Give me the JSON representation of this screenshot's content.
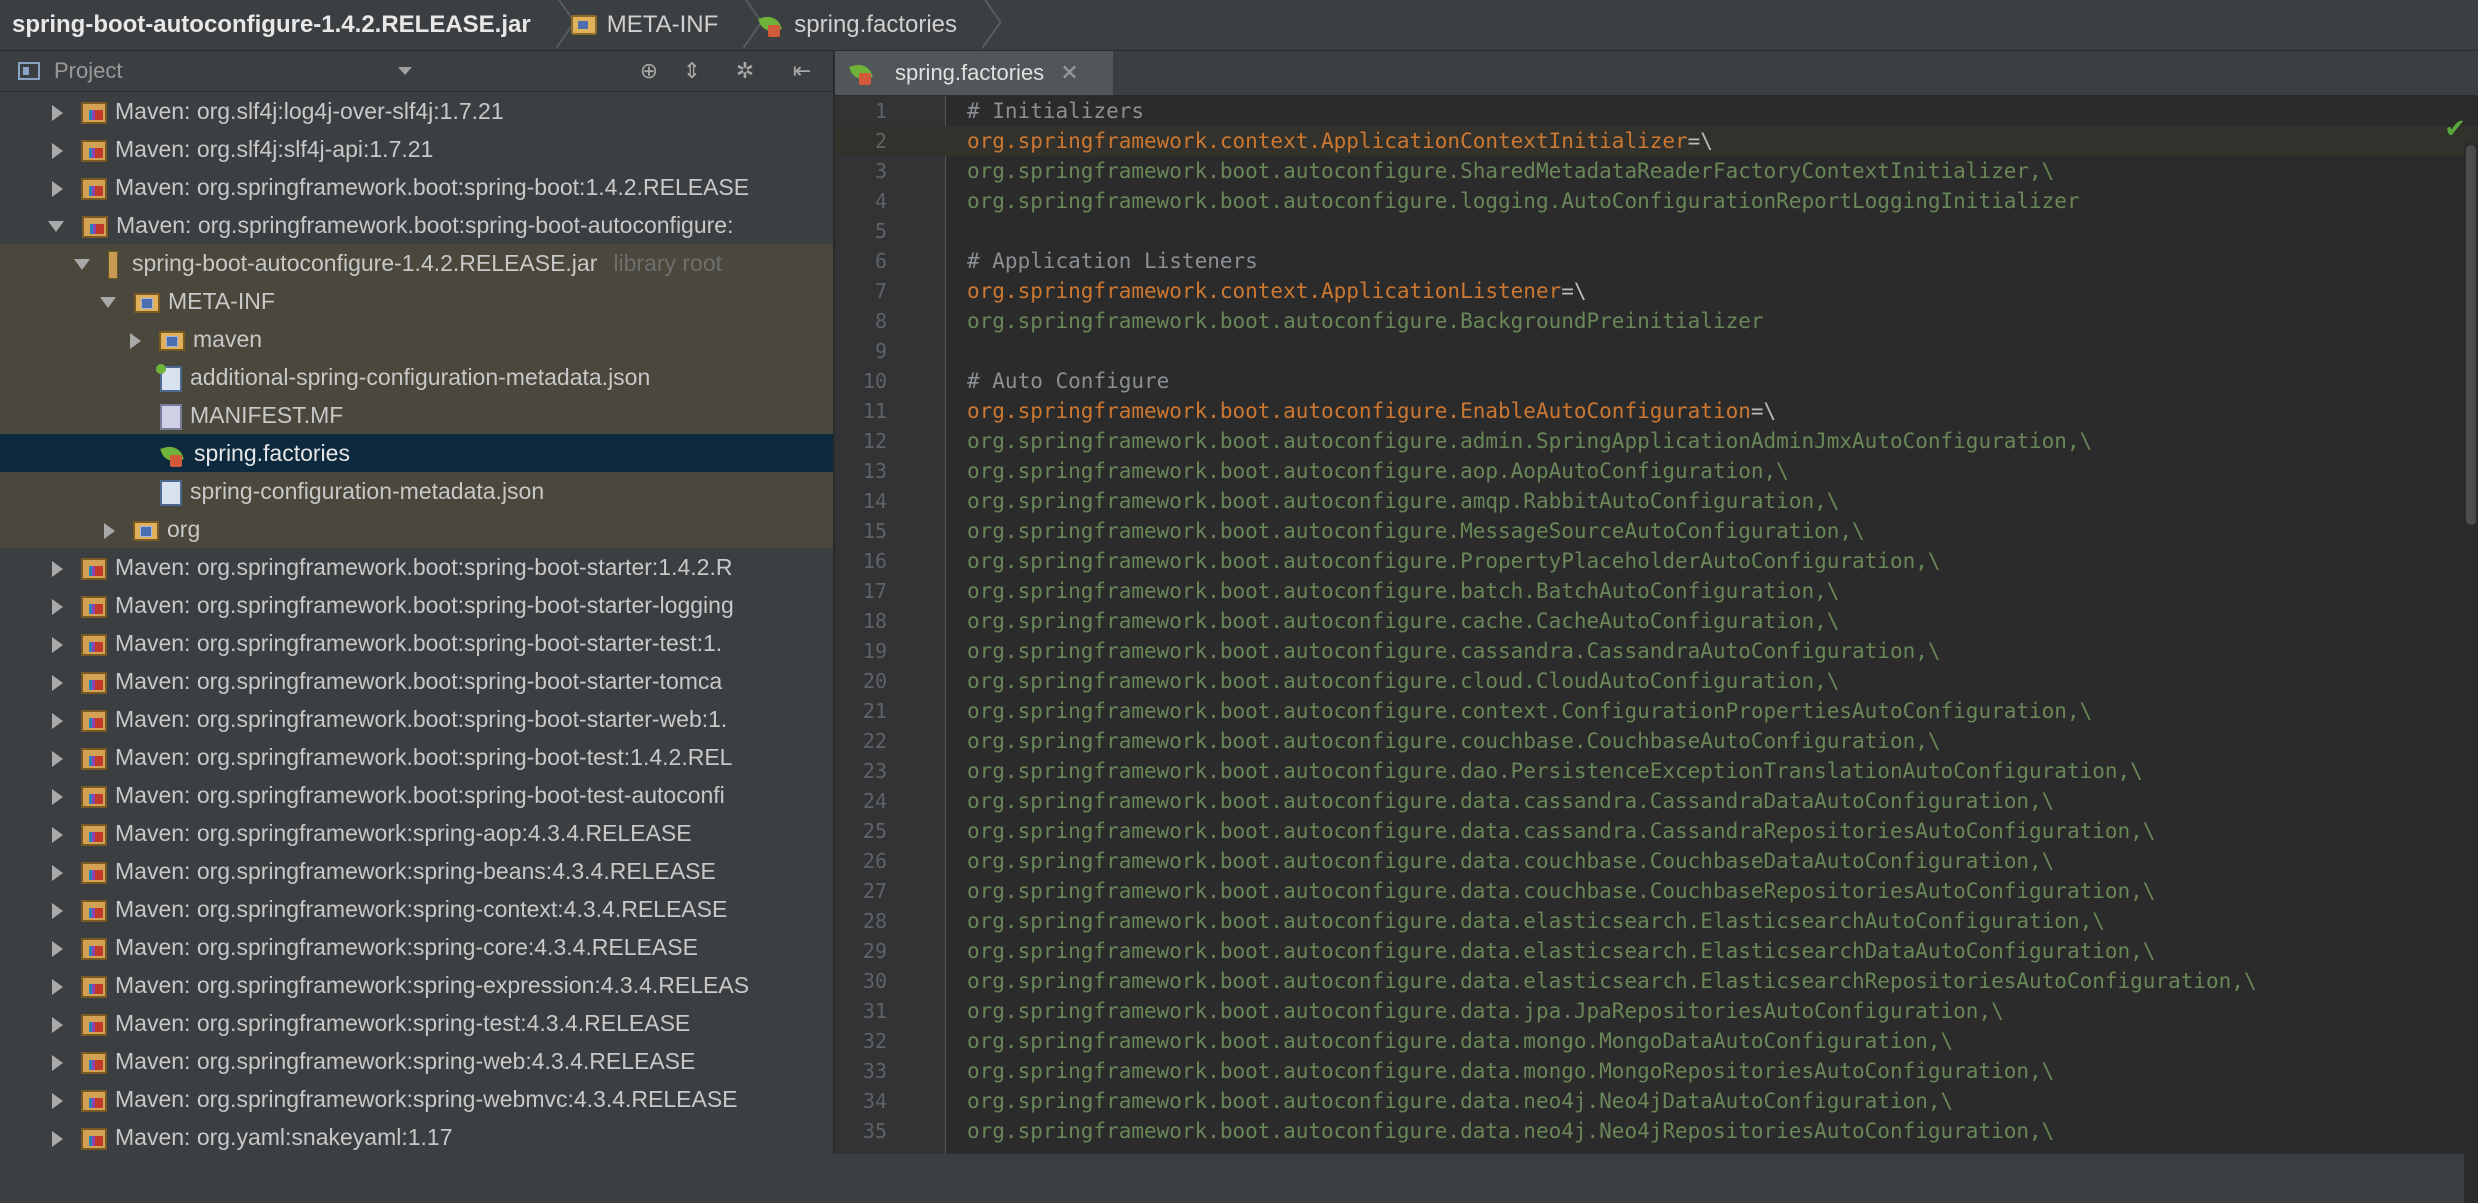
{
  "breadcrumb": {
    "jar": "spring-boot-autoconfigure-1.4.2.RELEASE.jar",
    "folder": "META-INF",
    "file": "spring.factories"
  },
  "project_panel": {
    "title": "Project",
    "tree": [
      {
        "label": "Maven: org.slf4j:log4j-over-slf4j:1.7.21",
        "expander": "right",
        "icon": "library-icon",
        "indent": 0
      },
      {
        "label": "Maven: org.slf4j:slf4j-api:1.7.21",
        "expander": "right",
        "icon": "library-icon",
        "indent": 0
      },
      {
        "label": "Maven: org.springframework.boot:spring-boot:1.4.2.RELEASE",
        "expander": "right",
        "icon": "library-icon",
        "indent": 0
      },
      {
        "label": "Maven: org.springframework.boot:spring-boot-autoconfigure:",
        "expander": "down",
        "icon": "library-icon",
        "indent": 0
      },
      {
        "label": "spring-boot-autoconfigure-1.4.2.RELEASE.jar",
        "suffix": "library root",
        "expander": "down",
        "icon": "jar-icon",
        "indent": 1,
        "shaded": true
      },
      {
        "label": "META-INF",
        "expander": "down",
        "icon": "folder-icon",
        "indent": 2,
        "shaded": true
      },
      {
        "label": "maven",
        "expander": "right",
        "icon": "folder-icon",
        "indent": 3,
        "shaded": true
      },
      {
        "label": "additional-spring-configuration-metadata.json",
        "expander": "none",
        "icon": "json-add-icon",
        "indent": 3,
        "shaded": true
      },
      {
        "label": "MANIFEST.MF",
        "expander": "none",
        "icon": "manifest-icon",
        "indent": 3,
        "shaded": true
      },
      {
        "label": "spring.factories",
        "expander": "none",
        "icon": "spring-leaf-icon",
        "indent": 3,
        "selected": true
      },
      {
        "label": "spring-configuration-metadata.json",
        "expander": "none",
        "icon": "json-icon",
        "indent": 3,
        "shaded": true
      },
      {
        "label": "org",
        "expander": "right",
        "icon": "folder-icon",
        "indent": 2,
        "shaded": true
      },
      {
        "label": "Maven: org.springframework.boot:spring-boot-starter:1.4.2.R",
        "expander": "right",
        "icon": "library-icon",
        "indent": 0
      },
      {
        "label": "Maven: org.springframework.boot:spring-boot-starter-logging",
        "expander": "right",
        "icon": "library-icon",
        "indent": 0
      },
      {
        "label": "Maven: org.springframework.boot:spring-boot-starter-test:1.",
        "expander": "right",
        "icon": "library-icon",
        "indent": 0
      },
      {
        "label": "Maven: org.springframework.boot:spring-boot-starter-tomca",
        "expander": "right",
        "icon": "library-icon",
        "indent": 0
      },
      {
        "label": "Maven: org.springframework.boot:spring-boot-starter-web:1.",
        "expander": "right",
        "icon": "library-icon",
        "indent": 0
      },
      {
        "label": "Maven: org.springframework.boot:spring-boot-test:1.4.2.REL",
        "expander": "right",
        "icon": "library-icon",
        "indent": 0
      },
      {
        "label": "Maven: org.springframework.boot:spring-boot-test-autoconfi",
        "expander": "right",
        "icon": "library-icon",
        "indent": 0
      },
      {
        "label": "Maven: org.springframework:spring-aop:4.3.4.RELEASE",
        "expander": "right",
        "icon": "library-icon",
        "indent": 0
      },
      {
        "label": "Maven: org.springframework:spring-beans:4.3.4.RELEASE",
        "expander": "right",
        "icon": "library-icon",
        "indent": 0
      },
      {
        "label": "Maven: org.springframework:spring-context:4.3.4.RELEASE",
        "expander": "right",
        "icon": "library-icon",
        "indent": 0
      },
      {
        "label": "Maven: org.springframework:spring-core:4.3.4.RELEASE",
        "expander": "right",
        "icon": "library-icon",
        "indent": 0
      },
      {
        "label": "Maven: org.springframework:spring-expression:4.3.4.RELEAS",
        "expander": "right",
        "icon": "library-icon",
        "indent": 0
      },
      {
        "label": "Maven: org.springframework:spring-test:4.3.4.RELEASE",
        "expander": "right",
        "icon": "library-icon",
        "indent": 0
      },
      {
        "label": "Maven: org.springframework:spring-web:4.3.4.RELEASE",
        "expander": "right",
        "icon": "library-icon",
        "indent": 0
      },
      {
        "label": "Maven: org.springframework:spring-webmvc:4.3.4.RELEASE",
        "expander": "right",
        "icon": "library-icon",
        "indent": 0
      },
      {
        "label": "Maven: org.yaml:snakeyaml:1.17",
        "expander": "right",
        "icon": "library-icon",
        "indent": 0
      }
    ]
  },
  "editor": {
    "tab_label": "spring.factories",
    "close_glyph": "✕",
    "current_line": 2,
    "lines": [
      {
        "n": "1",
        "type": "comment",
        "text": "# Initializers"
      },
      {
        "n": "2",
        "type": "key",
        "text": "org.springframework.context.ApplicationContextInitializer",
        "eq": "=\\"
      },
      {
        "n": "3",
        "type": "val",
        "text": "org.springframework.boot.autoconfigure.SharedMetadataReaderFactoryContextInitializer,\\"
      },
      {
        "n": "4",
        "type": "val",
        "text": "org.springframework.boot.autoconfigure.logging.AutoConfigurationReportLoggingInitializer"
      },
      {
        "n": "5",
        "type": "blank",
        "text": ""
      },
      {
        "n": "6",
        "type": "comment",
        "text": "# Application Listeners"
      },
      {
        "n": "7",
        "type": "key",
        "text": "org.springframework.context.ApplicationListener",
        "eq": "=\\"
      },
      {
        "n": "8",
        "type": "val",
        "text": "org.springframework.boot.autoconfigure.BackgroundPreinitializer"
      },
      {
        "n": "9",
        "type": "blank",
        "text": ""
      },
      {
        "n": "10",
        "type": "comment",
        "text": "# Auto Configure"
      },
      {
        "n": "11",
        "type": "key",
        "text": "org.springframework.boot.autoconfigure.EnableAutoConfiguration",
        "eq": "=\\"
      },
      {
        "n": "12",
        "type": "val",
        "text": "org.springframework.boot.autoconfigure.admin.SpringApplicationAdminJmxAutoConfiguration,\\"
      },
      {
        "n": "13",
        "type": "val",
        "text": "org.springframework.boot.autoconfigure.aop.AopAutoConfiguration,\\"
      },
      {
        "n": "14",
        "type": "val",
        "text": "org.springframework.boot.autoconfigure.amqp.RabbitAutoConfiguration,\\"
      },
      {
        "n": "15",
        "type": "val",
        "text": "org.springframework.boot.autoconfigure.MessageSourceAutoConfiguration,\\"
      },
      {
        "n": "16",
        "type": "val",
        "text": "org.springframework.boot.autoconfigure.PropertyPlaceholderAutoConfiguration,\\"
      },
      {
        "n": "17",
        "type": "val",
        "text": "org.springframework.boot.autoconfigure.batch.BatchAutoConfiguration,\\"
      },
      {
        "n": "18",
        "type": "val",
        "text": "org.springframework.boot.autoconfigure.cache.CacheAutoConfiguration,\\"
      },
      {
        "n": "19",
        "type": "val",
        "text": "org.springframework.boot.autoconfigure.cassandra.CassandraAutoConfiguration,\\"
      },
      {
        "n": "20",
        "type": "val",
        "text": "org.springframework.boot.autoconfigure.cloud.CloudAutoConfiguration,\\"
      },
      {
        "n": "21",
        "type": "val",
        "text": "org.springframework.boot.autoconfigure.context.ConfigurationPropertiesAutoConfiguration,\\"
      },
      {
        "n": "22",
        "type": "val",
        "text": "org.springframework.boot.autoconfigure.couchbase.CouchbaseAutoConfiguration,\\"
      },
      {
        "n": "23",
        "type": "val",
        "text": "org.springframework.boot.autoconfigure.dao.PersistenceExceptionTranslationAutoConfiguration,\\"
      },
      {
        "n": "24",
        "type": "val",
        "text": "org.springframework.boot.autoconfigure.data.cassandra.CassandraDataAutoConfiguration,\\"
      },
      {
        "n": "25",
        "type": "val",
        "text": "org.springframework.boot.autoconfigure.data.cassandra.CassandraRepositoriesAutoConfiguration,\\"
      },
      {
        "n": "26",
        "type": "val",
        "text": "org.springframework.boot.autoconfigure.data.couchbase.CouchbaseDataAutoConfiguration,\\"
      },
      {
        "n": "27",
        "type": "val",
        "text": "org.springframework.boot.autoconfigure.data.couchbase.CouchbaseRepositoriesAutoConfiguration,\\"
      },
      {
        "n": "28",
        "type": "val",
        "text": "org.springframework.boot.autoconfigure.data.elasticsearch.ElasticsearchAutoConfiguration,\\"
      },
      {
        "n": "29",
        "type": "val",
        "text": "org.springframework.boot.autoconfigure.data.elasticsearch.ElasticsearchDataAutoConfiguration,\\"
      },
      {
        "n": "30",
        "type": "val",
        "text": "org.springframework.boot.autoconfigure.data.elasticsearch.ElasticsearchRepositoriesAutoConfiguration,\\"
      },
      {
        "n": "31",
        "type": "val",
        "text": "org.springframework.boot.autoconfigure.data.jpa.JpaRepositoriesAutoConfiguration,\\"
      },
      {
        "n": "32",
        "type": "val",
        "text": "org.springframework.boot.autoconfigure.data.mongo.MongoDataAutoConfiguration,\\"
      },
      {
        "n": "33",
        "type": "val",
        "text": "org.springframework.boot.autoconfigure.data.mongo.MongoRepositoriesAutoConfiguration,\\"
      },
      {
        "n": "34",
        "type": "val",
        "text": "org.springframework.boot.autoconfigure.data.neo4j.Neo4jDataAutoConfiguration,\\"
      },
      {
        "n": "35",
        "type": "val",
        "text": "org.springframework.boot.autoconfigure.data.neo4j.Neo4jRepositoriesAutoConfiguration,\\"
      }
    ]
  },
  "colors": {
    "key": "#cc7832",
    "value": "#6a8759",
    "comment": "#8a8f93",
    "selection": "#0d293e",
    "shaded_row": "#4a473c"
  }
}
